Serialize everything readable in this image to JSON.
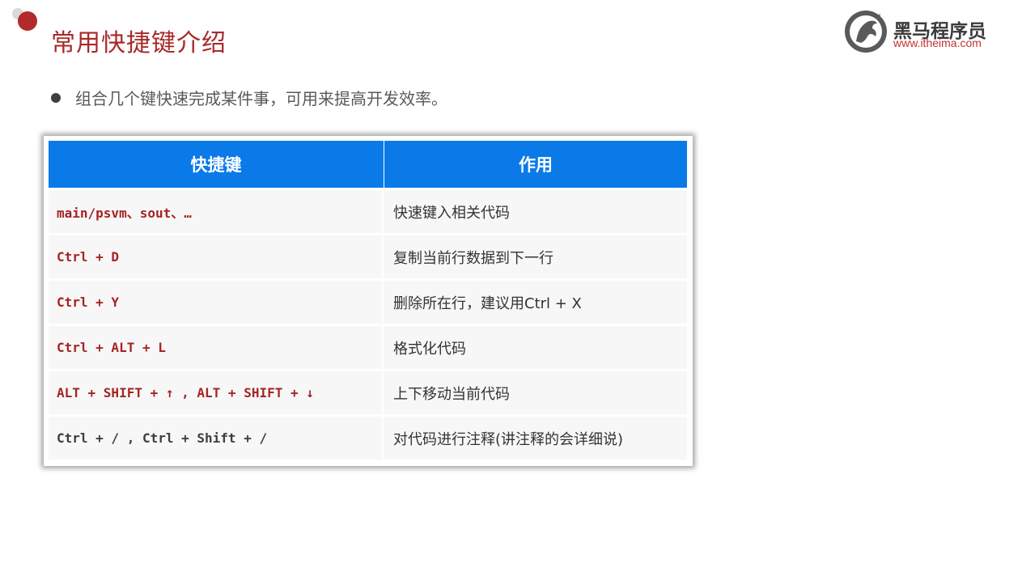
{
  "slide": {
    "title": "常用快捷键介绍",
    "bullet": "组合几个键快速完成某件事，可用来提高开发效率。"
  },
  "logo": {
    "name": "黑马程序员",
    "url": "www.itheima.com"
  },
  "table": {
    "headers": [
      "快捷键",
      "作用"
    ],
    "rows": [
      {
        "key": "main/psvm、sout、…",
        "action": "快速键入相关代码"
      },
      {
        "key": "Ctrl + D",
        "action": "复制当前行数据到下一行"
      },
      {
        "key": "Ctrl + Y",
        "action": "删除所在行，建议用Ctrl + X"
      },
      {
        "key": "Ctrl + ALT + L",
        "action": "格式化代码"
      },
      {
        "key": "ALT + SHIFT + ↑ , ALT + SHIFT + ↓",
        "action": "上下移动当前代码"
      },
      {
        "key": "Ctrl + / , Ctrl + Shift + /",
        "action": "对代码进行注释(讲注释的会详细说)"
      }
    ]
  },
  "colors": {
    "accent_red": "#a82a2a",
    "header_blue": "#0a7ae9",
    "key_red": "#a52424"
  }
}
